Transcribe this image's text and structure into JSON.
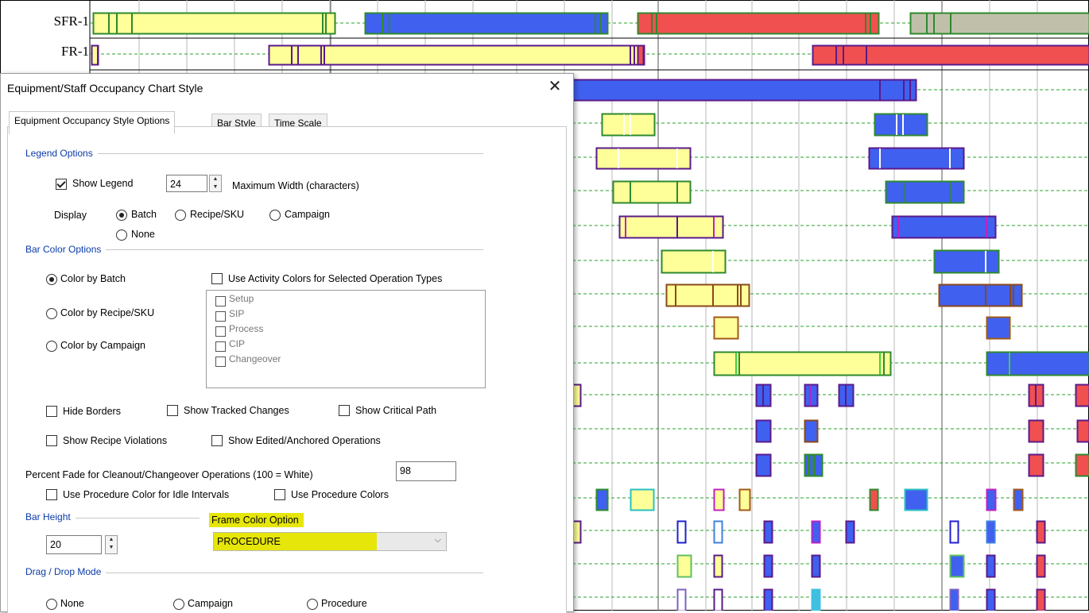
{
  "gantt": {
    "row_labels": [
      "SFR-1",
      "FR-1"
    ],
    "colors": {
      "yellow": "#ffff99",
      "blue": "#4060f0",
      "red": "#f05050",
      "gray": "#c0c0aa",
      "frame_green": "#2e8a2e",
      "frame_purple": "#5a1a8a",
      "grid_dash": "#2aa02a"
    }
  },
  "dialog": {
    "title": "Equipment/Staff Occupancy Chart Style",
    "close_glyph": "✕",
    "tabs": [
      "Equipment Occupancy Style Options",
      "Bar Style",
      "Time Scale"
    ],
    "active_tab": "Equipment Occupancy Style Options",
    "legend_options": {
      "group_label": "Legend Options",
      "show_legend_label": "Show Legend",
      "show_legend_checked": true,
      "max_width_value": "24",
      "max_width_label": "Maximum Width (characters)",
      "display_label": "Display",
      "display_options": [
        "Batch",
        "Recipe/SKU",
        "Campaign",
        "None"
      ],
      "display_selected": "Batch"
    },
    "bar_color_options": {
      "group_label": "Bar Color Options",
      "color_options": [
        "Color by Batch",
        "Color by Recipe/SKU",
        "Color by Campaign"
      ],
      "color_selected": "Color by Batch",
      "activity_colors_label": "Use Activity Colors for Selected Operation Types",
      "operation_types": [
        "Setup",
        "SIP",
        "Process",
        "CIP",
        "Changeover"
      ],
      "hide_borders_label": "Hide Borders",
      "show_tracked_changes_label": "Show Tracked Changes",
      "show_critical_path_label": "Show Critical Path",
      "show_recipe_violations_label": "Show Recipe Violations",
      "show_edited_anchored_label": "Show Edited/Anchored Operations",
      "percent_fade_label": "Percent Fade for Cleanout/Changeover Operations (100 = White)",
      "percent_fade_value": "98",
      "procedure_color_idle_label": "Use Procedure Color for Idle Intervals",
      "use_procedure_colors_label": "Use Procedure Colors"
    },
    "bar_height": {
      "group_label": "Bar Height",
      "value": "20"
    },
    "frame_color": {
      "label": "Frame Color Option",
      "value": "PROCEDURE",
      "highlight_color": "#e6e60a"
    },
    "drag_drop": {
      "group_label": "Drag / Drop Mode",
      "options": [
        "None",
        "Campaign",
        "Procedure"
      ]
    }
  }
}
